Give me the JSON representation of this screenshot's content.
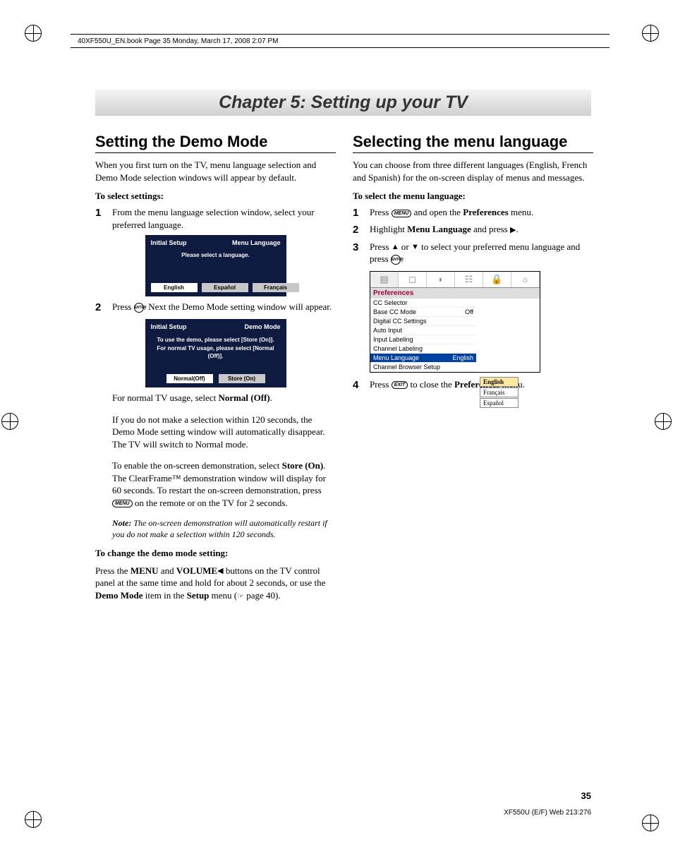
{
  "header": {
    "book_info": "40XF550U_EN.book  Page 35  Monday, March 17, 2008  2:07 PM"
  },
  "chapter": {
    "title": "Chapter 5: Setting up your TV"
  },
  "left": {
    "h2": "Setting the Demo Mode",
    "intro": "When you first turn on the TV, menu language selection and Demo Mode selection windows will appear by default.",
    "sub1": "To select settings:",
    "step1": "From the menu language selection window, select your preferred language.",
    "screen1": {
      "title_l": "Initial Setup",
      "title_r": "Menu Language",
      "msg": "Please select a language.",
      "btn1": "English",
      "btn2": "Español",
      "btn3": "Français"
    },
    "step2_a": "Press ",
    "step2_b": ". Next the Demo Mode setting window will appear.",
    "screen2": {
      "title_l": "Initial Setup",
      "title_r": "Demo Mode",
      "msg": "To use the demo, please select [Store (On)].\nFor normal TV usage, please select [Normal (Off)].",
      "btn1": "Normal(Off)",
      "btn2": "Store (On)"
    },
    "p3a": "For normal TV usage, select ",
    "p3b": "Normal (Off)",
    "p3c": ".",
    "p4": "If you do not make a selection within 120 seconds, the Demo Mode setting window will automatically disappear. The TV will switch to Normal mode.",
    "p5a": "To enable the on-screen demonstration, select ",
    "p5b": "Store (On)",
    "p5c": ". The ClearFrame™ demonstration window will display for 60 seconds. To restart the on-screen demonstration, press ",
    "p5d": " on the remote or on the TV for 2 seconds.",
    "note_label": "Note:",
    "note": " The on-screen demonstration will automatically restart if you do not make a selection within 120 seconds.",
    "sub2": "To change the demo mode setting:",
    "p6a": "Press the ",
    "p6b": "MENU",
    "p6c": " and ",
    "p6d": "VOLUME",
    "p6e": " buttons on the TV control panel at the same time and hold for about 2 seconds, or use the ",
    "p6f": "Demo Mode",
    "p6g": " item in the ",
    "p6h": "Setup",
    "p6i": " menu (",
    "p6j": " page 40)."
  },
  "right": {
    "h2": "Selecting the menu language",
    "intro": "You can choose from three different languages (English, French and Spanish) for the on-screen display of menus and messages.",
    "sub1": "To select the menu language:",
    "step1a": "Press ",
    "step1b": " and open the ",
    "step1c": "Preferences",
    "step1d": " menu.",
    "step2a": "Highlight ",
    "step2b": "Menu Language",
    "step2c": " and press ",
    "step2d": ".",
    "step3a": "Press ",
    "step3b": " or ",
    "step3c": " to select your preferred menu language and press ",
    "step3d": ".",
    "osd": {
      "title": "Preferences",
      "rows": [
        {
          "l": "CC Selector",
          "r": ""
        },
        {
          "l": "Base CC Mode",
          "r": "Off"
        },
        {
          "l": "Digital CC Settings",
          "r": ""
        },
        {
          "l": "Auto Input",
          "r": ""
        },
        {
          "l": "Input Labeling",
          "r": ""
        },
        {
          "l": "Channel Labeling",
          "r": ""
        },
        {
          "l": "Menu Language",
          "r": "English",
          "hl": true
        },
        {
          "l": "Channel Browser Setup",
          "r": ""
        }
      ],
      "side": [
        "English",
        "Français",
        "Español"
      ]
    },
    "step4a": "Press ",
    "step4b": " to close the ",
    "step4c": "Preferences",
    "step4d": " menu."
  },
  "keys": {
    "menu": "MENU",
    "enter": "ENTER",
    "exit": "EXIT"
  },
  "footer": {
    "page": "35",
    "ref": "XF550U (E/F) Web 213:276"
  }
}
